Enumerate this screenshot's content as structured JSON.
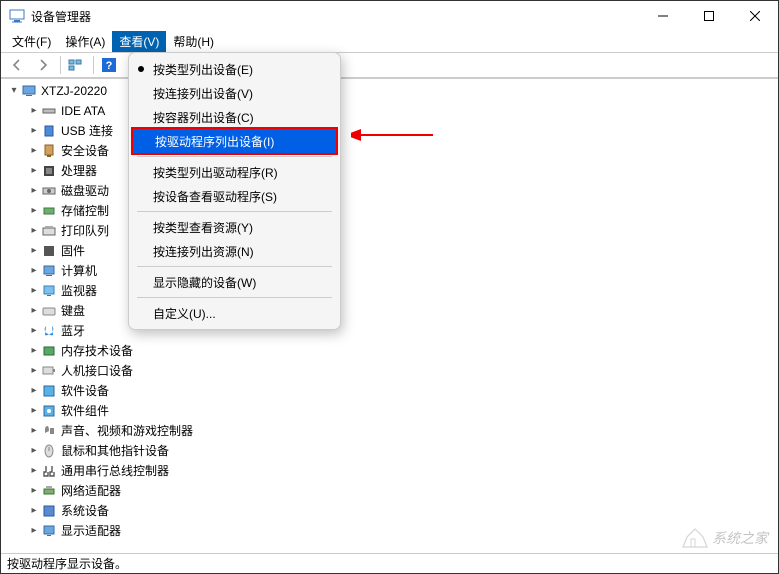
{
  "window": {
    "title": "设备管理器"
  },
  "menubar": {
    "file": "文件(F)",
    "action": "操作(A)",
    "view": "查看(V)",
    "help": "帮助(H)"
  },
  "dropdown": {
    "items": [
      "按类型列出设备(E)",
      "按连接列出设备(V)",
      "按容器列出设备(C)",
      "按驱动程序列出设备(I)",
      "按类型列出驱动程序(R)",
      "按设备查看驱动程序(S)",
      "按类型查看资源(Y)",
      "按连接列出资源(N)",
      "显示隐藏的设备(W)",
      "自定义(U)..."
    ],
    "bullet_index": 0,
    "highlight_index": 3
  },
  "tree": {
    "root": "XTZJ-20220",
    "children": [
      "IDE ATA",
      "USB 连接",
      "安全设备",
      "处理器",
      "磁盘驱动",
      "存储控制",
      "打印队列",
      "固件",
      "计算机",
      "监视器",
      "键盘",
      "蓝牙",
      "内存技术设备",
      "人机接口设备",
      "软件设备",
      "软件组件",
      "声音、视频和游戏控制器",
      "鼠标和其他指针设备",
      "通用串行总线控制器",
      "网络适配器",
      "系统设备",
      "显示适配器"
    ]
  },
  "statusbar": {
    "text": "按驱动程序显示设备。"
  },
  "watermark": {
    "text": "系统之家"
  }
}
